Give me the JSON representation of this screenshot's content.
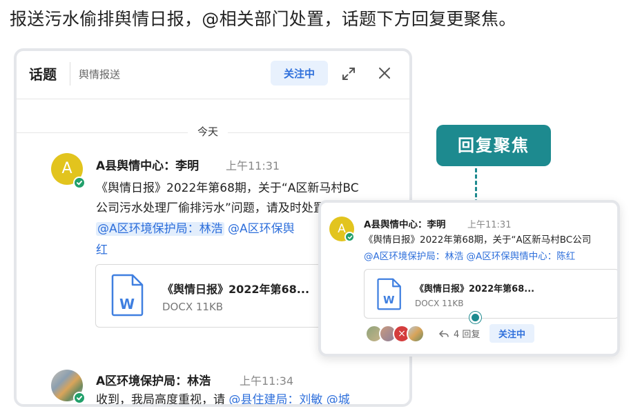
{
  "headline": "报送污水偷排舆情日报，@相关部门处置，话题下方回复更聚焦。",
  "panel": {
    "title": "话题",
    "subtitle": "舆情报送",
    "follow_label": "关注中",
    "day_label": "今天"
  },
  "messages": [
    {
      "avatar_letter": "A",
      "author": "A县舆情中心：李明",
      "time": "上午11:31",
      "line1": "《舆情日报》2022年第68期，关于“A区新马村BC",
      "line2": "公司污水处理厂偷排污水”问题，请及时处置",
      "mention1": "@A区环境保护局：林浩",
      "mention2": "@A区环保舆",
      "mention2_cont": "红",
      "file_name": "《舆情日报》2022年第68...",
      "file_meta": "DOCX 11KB",
      "file_letter": "W"
    },
    {
      "author": "A区环境保护局：林浩",
      "time": "上午11:34",
      "text_plain": "收到，我局高度重视，请",
      "mention": "@县住建局：刘敏 @城"
    }
  ],
  "callout": {
    "label": "回复聚焦"
  },
  "overlay": {
    "avatar_letter": "A",
    "author": "A县舆情中心：李明",
    "time": "上午11:31",
    "line1": "《舆情日报》2022年第68期，关于“A区新马村BC公司",
    "mentions": "@A区环境保护局：林浩 @A区环保舆情中心：陈红",
    "file_name": "《舆情日报》2022年第68...",
    "file_meta": "DOCX 11KB",
    "file_letter": "W",
    "reply_count": "4 回复",
    "follow_label": "关注中",
    "reply_avatar_x": "×"
  },
  "colors": {
    "accent_blue": "#2e6fdb",
    "teal": "#1d8a8f",
    "avatar_yellow": "#e2c41e",
    "verified_green": "#22a06b"
  }
}
